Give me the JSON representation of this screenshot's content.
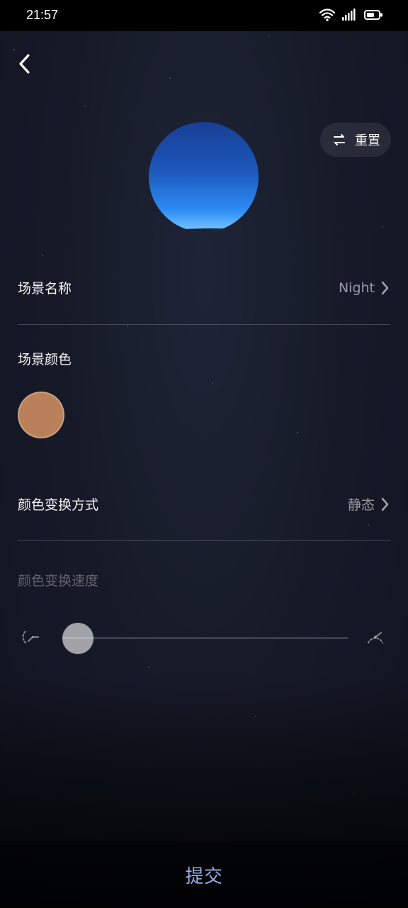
{
  "status_bar": {
    "time": "21:57"
  },
  "header": {
    "back_icon": "chevron-left-icon",
    "reset_label": "重置",
    "reset_icon": "refresh-icon"
  },
  "scene_name": {
    "label": "场景名称",
    "value": "Night"
  },
  "scene_color": {
    "label": "场景颜色",
    "swatch_color": "#b98059"
  },
  "color_transition": {
    "label": "颜色变换方式",
    "value": "静态"
  },
  "color_speed": {
    "label": "颜色变换速度",
    "value": 0
  },
  "submit": {
    "label": "提交"
  }
}
